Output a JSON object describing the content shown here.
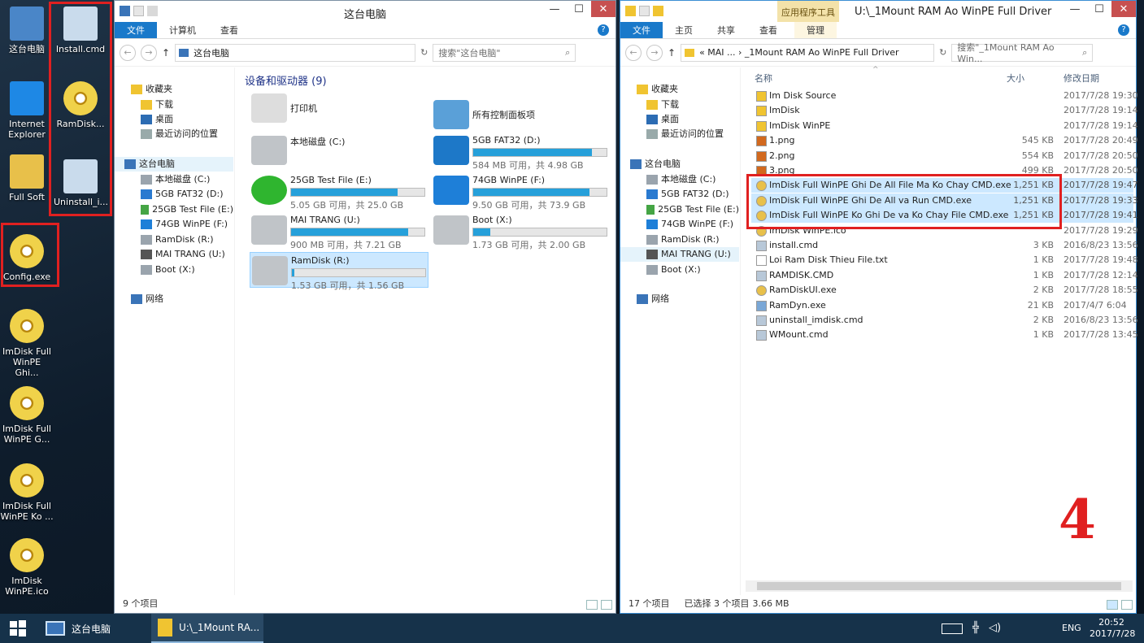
{
  "desktop": {
    "icons": [
      {
        "label": "这台电脑"
      },
      {
        "label": "Internet Explorer"
      },
      {
        "label": "Full Soft"
      },
      {
        "label": "Config.exe"
      },
      {
        "label": "ImDisk Full WinPE Ghi..."
      },
      {
        "label": "ImDisk Full WinPE G..."
      },
      {
        "label": "ImDisk Full WinPE Ko ..."
      },
      {
        "label": "ImDisk WinPE.ico"
      },
      {
        "label": "Install.cmd"
      },
      {
        "label": "RamDisk..."
      },
      {
        "label": "Uninstall_i..."
      }
    ]
  },
  "left_window": {
    "title": "这台电脑",
    "ribbon_tabs": [
      "文件",
      "计算机",
      "查看"
    ],
    "address": "这台电脑",
    "search_placeholder": "搜索\"这台电脑\"",
    "nav": [
      "收藏夹",
      "下载",
      "桌面",
      "最近访问的位置",
      "这台电脑",
      "本地磁盘 (C:)",
      "5GB FAT32 (D:)",
      "25GB Test File (E:)",
      "74GB WinPE (F:)",
      "RamDisk (R:)",
      "MAI TRANG (U:)",
      "Boot (X:)",
      "网络"
    ],
    "group_header": "设备和驱动器 (9)",
    "items": [
      {
        "name": "打印机",
        "size": "",
        "fill": 0
      },
      {
        "name": "所有控制面板项",
        "size": "",
        "fill": 0
      },
      {
        "name": "本地磁盘 (C:)",
        "size": "",
        "fill": 0
      },
      {
        "name": "5GB FAT32 (D:)",
        "size": "584 MB 可用，共 4.98 GB",
        "fill": 0.89
      },
      {
        "name": "25GB Test File (E:)",
        "size": "5.05 GB 可用，共 25.0 GB",
        "fill": 0.8
      },
      {
        "name": "74GB WinPE (F:)",
        "size": "9.50 GB 可用，共 73.9 GB",
        "fill": 0.87
      },
      {
        "name": "MAI TRANG (U:)",
        "size": "900 MB 可用，共 7.21 GB",
        "fill": 0.88
      },
      {
        "name": "Boot (X:)",
        "size": "1.73 GB 可用，共 2.00 GB",
        "fill": 0.13
      },
      {
        "name": "RamDisk (R:)",
        "size": "1.53 GB 可用，共 1.56 GB",
        "fill": 0.02
      }
    ],
    "status": "9 个项目"
  },
  "right_window": {
    "title": "U:\\_1Mount RAM Ao WinPE Full Driver",
    "context_tab": "应用程序工具",
    "ribbon_tabs": [
      "文件",
      "主页",
      "共享",
      "查看",
      "管理"
    ],
    "address": "«  MAI ... › _1Mount RAM Ao WinPE Full Driver",
    "search_placeholder": "搜索\"_1Mount RAM Ao Win...",
    "nav": [
      "收藏夹",
      "下载",
      "桌面",
      "最近访问的位置",
      "这台电脑",
      "本地磁盘 (C:)",
      "5GB FAT32 (D:)",
      "25GB Test File (E:)",
      "74GB WinPE (F:)",
      "RamDisk (R:)",
      "MAI TRANG (U:)",
      "Boot (X:)",
      "网络"
    ],
    "columns": {
      "name": "名称",
      "size": "大小",
      "date": "修改日期"
    },
    "files": [
      {
        "name": "Im Disk Source",
        "size": "",
        "date": "2017/7/28 19:30",
        "type": "folder"
      },
      {
        "name": "ImDisk",
        "size": "",
        "date": "2017/7/28 19:14",
        "type": "folder"
      },
      {
        "name": "ImDisk WinPE",
        "size": "",
        "date": "2017/7/28 19:14",
        "type": "folder"
      },
      {
        "name": "1.png",
        "size": "545 KB",
        "date": "2017/7/28 20:49",
        "type": "png"
      },
      {
        "name": "2.png",
        "size": "554 KB",
        "date": "2017/7/28 20:50",
        "type": "png"
      },
      {
        "name": "3.png",
        "size": "499 KB",
        "date": "2017/7/28 20:50",
        "type": "png"
      },
      {
        "name": "ImDisk Full WinPE Ghi De All File Ma Ko Chay CMD.exe",
        "size": "1,251 KB",
        "date": "2017/7/28 19:47",
        "type": "exe",
        "selected": true
      },
      {
        "name": "ImDisk Full WinPE Ghi De All va Run CMD.exe",
        "size": "1,251 KB",
        "date": "2017/7/28 19:33",
        "type": "exe",
        "selected": true
      },
      {
        "name": "ImDisk Full WinPE Ko Ghi De va Ko Chay File CMD.exe",
        "size": "1,251 KB",
        "date": "2017/7/28 19:41",
        "type": "exe",
        "selected": true
      },
      {
        "name": "ImDisk WinPE.ico",
        "size": "",
        "date": "2017/7/28 19:29",
        "type": "ico"
      },
      {
        "name": "install.cmd",
        "size": "3 KB",
        "date": "2016/8/23 13:56",
        "type": "cmd"
      },
      {
        "name": "Loi Ram Disk Thieu File.txt",
        "size": "1 KB",
        "date": "2017/7/28 19:48",
        "type": "txt"
      },
      {
        "name": "RAMDISK.CMD",
        "size": "1 KB",
        "date": "2017/7/28 12:14",
        "type": "cmd"
      },
      {
        "name": "RamDiskUI.exe",
        "size": "2 KB",
        "date": "2017/7/28 18:55",
        "type": "exe"
      },
      {
        "name": "RamDyn.exe",
        "size": "21 KB",
        "date": "2017/4/7 6:04",
        "type": "app"
      },
      {
        "name": "uninstall_imdisk.cmd",
        "size": "2 KB",
        "date": "2016/8/23 13:56",
        "type": "cmd"
      },
      {
        "name": "WMount.cmd",
        "size": "1 KB",
        "date": "2017/7/28 13:45",
        "type": "cmd"
      }
    ],
    "status_count": "17 个项目",
    "status_selected": "已选择 3 个项目",
    "status_size": "3.66 MB",
    "annotation": "4"
  },
  "taskbar": {
    "items": [
      "这台电脑",
      "U:\\_1Mount RA..."
    ],
    "lang": "ENG",
    "time": "20:52",
    "date": "2017/7/28"
  }
}
